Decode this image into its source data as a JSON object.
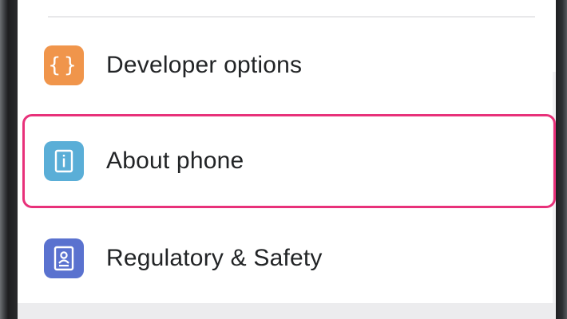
{
  "settings_list": {
    "items": [
      {
        "label": "Developer options",
        "icon": "braces-icon",
        "icon_color": "#f0954b",
        "highlighted": false
      },
      {
        "label": "About phone",
        "icon": "info-icon",
        "icon_color": "#5aaed7",
        "highlighted": true
      },
      {
        "label": "Regulatory & Safety",
        "icon": "badge-icon",
        "icon_color": "#5a72cf",
        "highlighted": false
      }
    ]
  },
  "colors": {
    "highlight_border": "#e8317a",
    "text": "#222426",
    "screen_background": "#ffffff"
  }
}
